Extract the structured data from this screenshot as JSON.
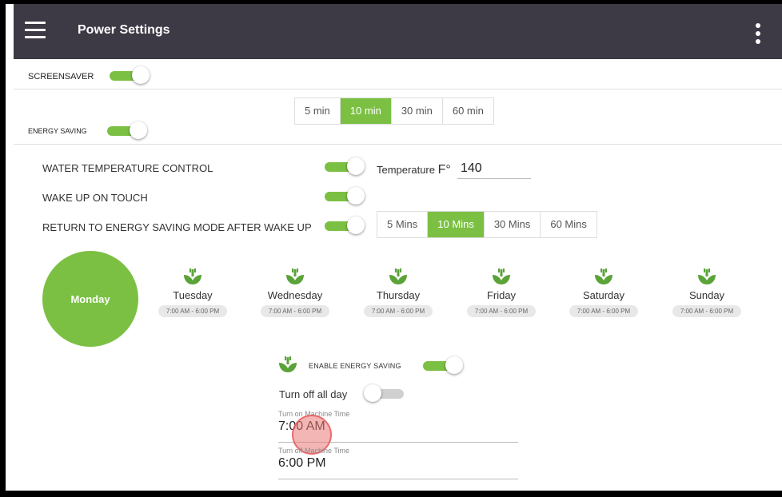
{
  "app": {
    "title": "Power Settings"
  },
  "screensaver": {
    "label": "SCREENSAVER",
    "enabled": true,
    "options": [
      "5 min",
      "10 min",
      "30 min",
      "60 min"
    ],
    "selected": "10 min"
  },
  "energy_saving": {
    "label": "ENERGY SAVING",
    "enabled": true
  },
  "water_temp": {
    "label": "WATER TEMPERATURE CONTROL",
    "enabled": true,
    "temp_label": "Temperature",
    "temp_unit": "F°",
    "temp_value": "140"
  },
  "wake_up": {
    "label": "WAKE UP ON TOUCH",
    "enabled": true
  },
  "return_mode": {
    "label": "RETURN TO ENERGY SAVING MODE AFTER WAKE UP",
    "enabled": true,
    "options": [
      "5 Mins",
      "10 Mins",
      "30 Mins",
      "60 Mins"
    ],
    "selected": "10 Mins"
  },
  "days": [
    {
      "name": "Monday",
      "selected": true
    },
    {
      "name": "Tuesday",
      "range": "7:00 AM - 6:00 PM"
    },
    {
      "name": "Wednesday",
      "range": "7:00 AM - 6:00 PM"
    },
    {
      "name": "Thursday",
      "range": "7:00 AM - 6:00 PM"
    },
    {
      "name": "Friday",
      "range": "7:00 AM - 6:00 PM"
    },
    {
      "name": "Saturday",
      "range": "7:00 AM - 6:00 PM"
    },
    {
      "name": "Sunday",
      "range": "7:00 AM - 6:00 PM"
    }
  ],
  "day_settings": {
    "enable_label": "ENABLE ENERGY SAVING",
    "enable_on": true,
    "turn_off_label": "Turn off all day",
    "turn_off_on": false,
    "on_time_label": "Turn on Machine Time",
    "on_time": "7:00 AM",
    "off_time_label": "Turn off Machine Time",
    "off_time": "6:00 PM"
  },
  "icons": {
    "menu": "hamburger-menu-icon",
    "more": "more-vert-icon",
    "day": "eco-leaf-icon"
  },
  "colors": {
    "accent": "#7bc043",
    "appbar": "#3d3a46"
  }
}
